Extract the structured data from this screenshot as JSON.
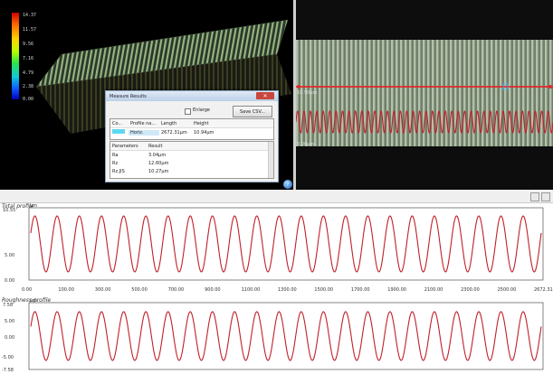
{
  "left_view": {
    "scale_labels": [
      "14.37",
      "11.57",
      "9.56",
      "7.16",
      "4.79",
      "2.38",
      "0.00"
    ]
  },
  "dialog": {
    "title": "Measure Results",
    "close_glyph": "✕",
    "enlarge_label": "Enlarge",
    "save_label": "Save CSV...",
    "profile_headers": [
      "Co...",
      "Profile na...",
      "Length",
      "Height"
    ],
    "profile_row": {
      "name": "Horiz.",
      "length": "2672.31μm",
      "height": "10.94μm"
    },
    "param_headers": [
      "Parameters",
      "Result"
    ],
    "params": [
      {
        "name": "Ra",
        "value": "3.04μm"
      },
      {
        "name": "Rz",
        "value": "12.60μm"
      },
      {
        "name": "Rz.JIS",
        "value": "10.27μm"
      }
    ]
  },
  "right_view": {
    "label_top": "10.50μm",
    "label_bottom": "0.00μm"
  },
  "help_glyph": "?",
  "total_profile": {
    "title": "Total profile",
    "unit": "μm",
    "y_ticks": [
      "10.55",
      "5.00",
      "0.00"
    ],
    "x_ticks": [
      "0.00",
      "100.00",
      "300.00",
      "500.00",
      "700.00",
      "900.00",
      "1100.00",
      "1300.00",
      "1500.00",
      "1700.00",
      "1900.00",
      "2100.00",
      "2300.00",
      "2500.00",
      "2672.31"
    ]
  },
  "roughness_profile": {
    "title": "Roughness profile",
    "unit": "μm",
    "y_ticks": [
      "7.58",
      "5.00",
      "0.00",
      "-5.00",
      "-7.58"
    ]
  },
  "colors": {
    "signal": "#c0202a",
    "measure_line": "#e02a2a",
    "grating_stripe": "#9fb07f"
  }
}
